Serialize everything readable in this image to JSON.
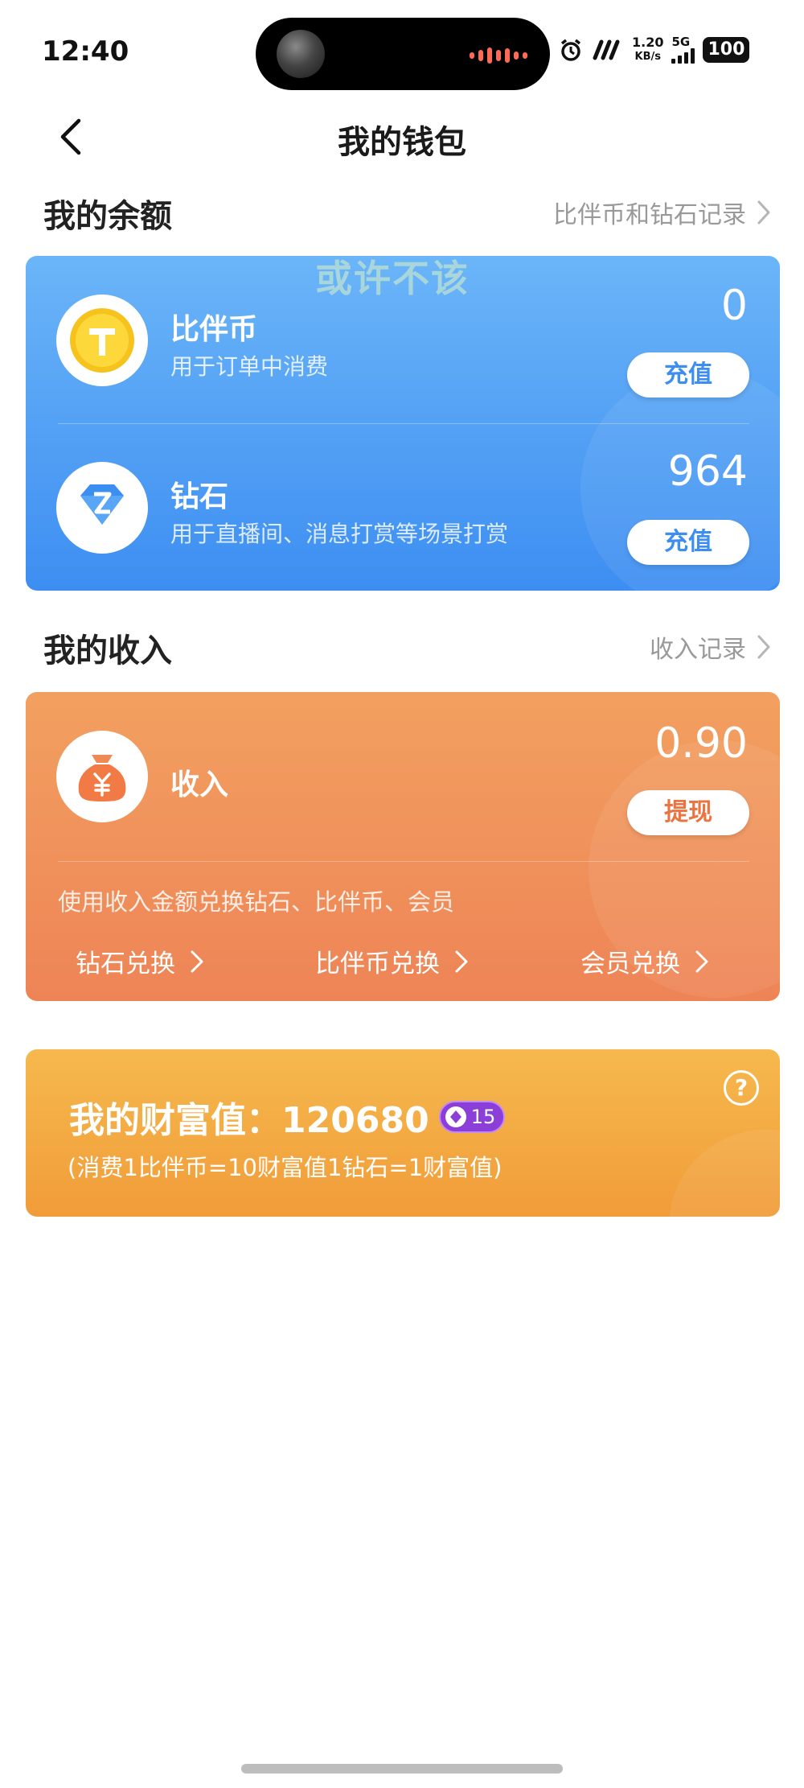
{
  "status_bar": {
    "time": "12:40",
    "net_speed_value": "1.20",
    "net_speed_unit": "KB/s",
    "network": "5G",
    "battery": "100"
  },
  "nav": {
    "title": "我的钱包",
    "back_icon": "chevron-left-icon"
  },
  "balance": {
    "section_title": "我的余额",
    "record_link": "比伴币和钻石记录",
    "watermark": "或许不该",
    "items": [
      {
        "name": "比伴币",
        "desc": "用于订单中消费",
        "value": "0",
        "button": "充值",
        "icon": "coin-icon"
      },
      {
        "name": "钻石",
        "desc": "用于直播间、消息打赏等场景打赏",
        "value": "964",
        "button": "充值",
        "icon": "diamond-icon"
      }
    ]
  },
  "income": {
    "section_title": "我的收入",
    "record_link": "收入记录",
    "name": "收入",
    "value": "0.90",
    "button": "提现",
    "icon": "money-bag-icon",
    "note": "使用收入金额兑换钻石、比伴币、会员",
    "exchanges": [
      "钻石兑换",
      "比伴币兑换",
      "会员兑换"
    ]
  },
  "wealth": {
    "title": "我的财富值：120680",
    "level": "15",
    "note": "(消费1比伴币=10财富值1钻石=1财富值)",
    "help": "?"
  },
  "colors": {
    "blue_card": "#4a9af4",
    "orange_card": "#ef8b58",
    "gold_card": "#f4ab44",
    "accent_blue": "#3c8ef0",
    "accent_orange": "#ea7543",
    "level_purple": "#8b3fd8"
  }
}
